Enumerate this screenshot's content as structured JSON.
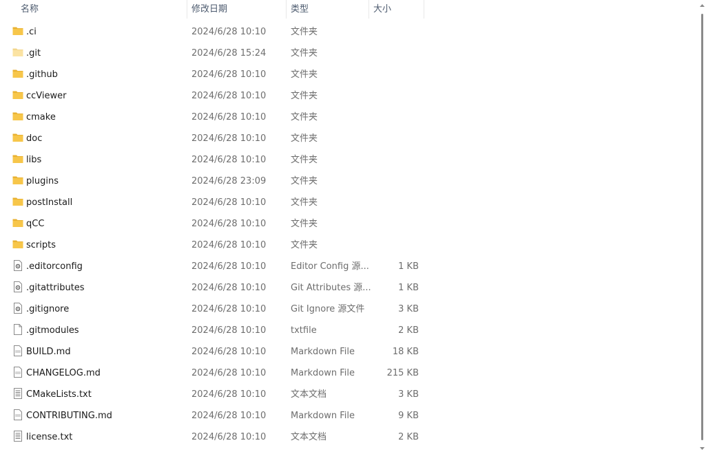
{
  "columns": {
    "name": "名称",
    "modified": "修改日期",
    "type": "类型",
    "size": "大小"
  },
  "files": [
    {
      "name": ".ci",
      "date": "2024/6/28 10:10",
      "type": "文件夹",
      "size": "",
      "icon": "folder-icon"
    },
    {
      "name": ".git",
      "date": "2024/6/28 15:24",
      "type": "文件夹",
      "size": "",
      "icon": "folder-hidden-icon"
    },
    {
      "name": ".github",
      "date": "2024/6/28 10:10",
      "type": "文件夹",
      "size": "",
      "icon": "folder-icon"
    },
    {
      "name": "ccViewer",
      "date": "2024/6/28 10:10",
      "type": "文件夹",
      "size": "",
      "icon": "folder-icon"
    },
    {
      "name": "cmake",
      "date": "2024/6/28 10:10",
      "type": "文件夹",
      "size": "",
      "icon": "folder-icon"
    },
    {
      "name": "doc",
      "date": "2024/6/28 10:10",
      "type": "文件夹",
      "size": "",
      "icon": "folder-icon"
    },
    {
      "name": "libs",
      "date": "2024/6/28 10:10",
      "type": "文件夹",
      "size": "",
      "icon": "folder-icon"
    },
    {
      "name": "plugins",
      "date": "2024/6/28 23:09",
      "type": "文件夹",
      "size": "",
      "icon": "folder-icon"
    },
    {
      "name": "postInstall",
      "date": "2024/6/28 10:10",
      "type": "文件夹",
      "size": "",
      "icon": "folder-icon"
    },
    {
      "name": "qCC",
      "date": "2024/6/28 10:10",
      "type": "文件夹",
      "size": "",
      "icon": "folder-icon"
    },
    {
      "name": "scripts",
      "date": "2024/6/28 10:10",
      "type": "文件夹",
      "size": "",
      "icon": "folder-icon"
    },
    {
      "name": ".editorconfig",
      "date": "2024/6/28 10:10",
      "type": "Editor Config 源...",
      "size": "1 KB",
      "icon": "config-file-icon"
    },
    {
      "name": ".gitattributes",
      "date": "2024/6/28 10:10",
      "type": "Git Attributes 源...",
      "size": "1 KB",
      "icon": "config-file-icon"
    },
    {
      "name": ".gitignore",
      "date": "2024/6/28 10:10",
      "type": "Git Ignore 源文件",
      "size": "3 KB",
      "icon": "config-file-icon"
    },
    {
      "name": ".gitmodules",
      "date": "2024/6/28 10:10",
      "type": "txtfile",
      "size": "2 KB",
      "icon": "blank-file-icon"
    },
    {
      "name": "BUILD.md",
      "date": "2024/6/28 10:10",
      "type": "Markdown File",
      "size": "18 KB",
      "icon": "markdown-file-icon"
    },
    {
      "name": "CHANGELOG.md",
      "date": "2024/6/28 10:10",
      "type": "Markdown File",
      "size": "215 KB",
      "icon": "markdown-file-icon"
    },
    {
      "name": "CMakeLists.txt",
      "date": "2024/6/28 10:10",
      "type": "文本文档",
      "size": "3 KB",
      "icon": "text-file-icon"
    },
    {
      "name": "CONTRIBUTING.md",
      "date": "2024/6/28 10:10",
      "type": "Markdown File",
      "size": "9 KB",
      "icon": "markdown-file-icon"
    },
    {
      "name": "license.txt",
      "date": "2024/6/28 10:10",
      "type": "文本文档",
      "size": "2 KB",
      "icon": "text-file-icon"
    }
  ],
  "colors": {
    "folder": "#f7c64a",
    "folder_hidden": "#fbe3a3",
    "header_text": "#4c5a6e",
    "detail_text": "#6d6d6d"
  }
}
